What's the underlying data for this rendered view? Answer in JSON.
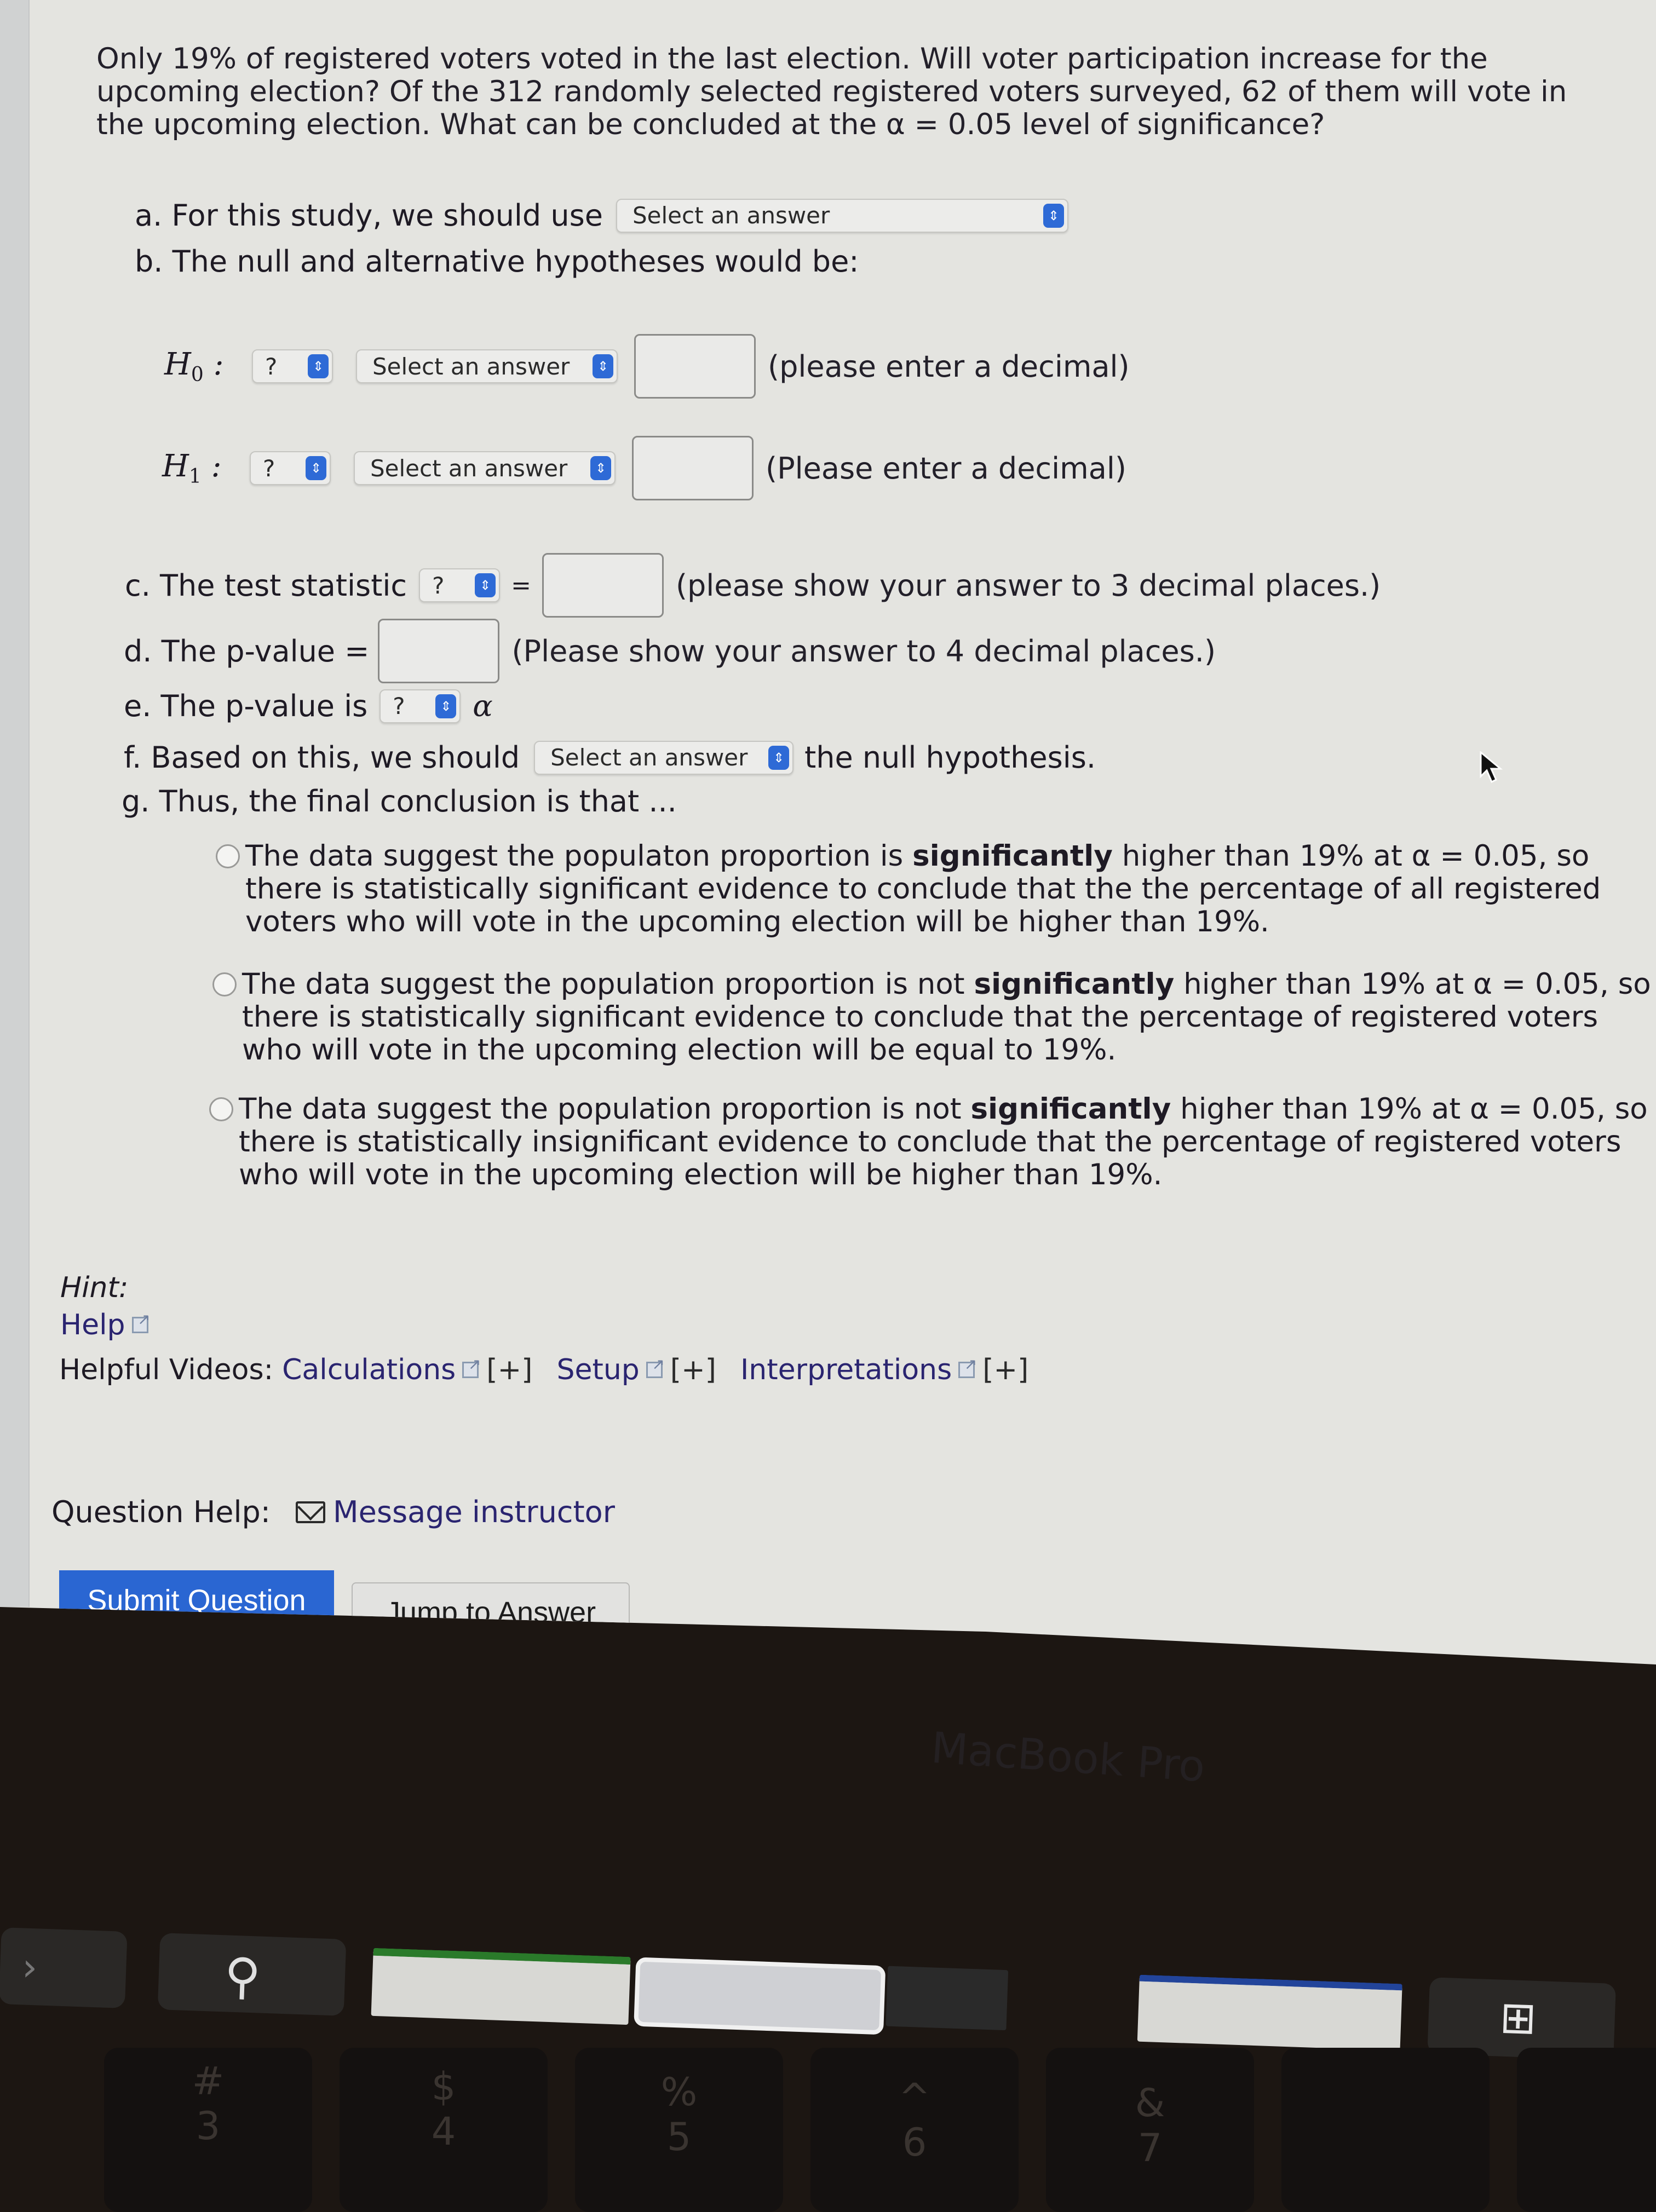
{
  "question": {
    "text": "Only 19% of registered voters voted in the last election. Will voter participation increase for the upcoming election? Of the 312 randomly selected registered voters surveyed, 62 of them will vote in the upcoming election. What can be concluded at the α = 0.05 level of significance?"
  },
  "part_a": {
    "label": "a. For this study, we should use",
    "select_value": "Select an answer"
  },
  "part_b": {
    "label": "b. The null and alternative hypotheses would be:",
    "h0": {
      "symbol": "H",
      "subscript": "0",
      "colon": ":",
      "param_select": "?",
      "op_select": "Select an answer",
      "value": "",
      "note": "(please enter a decimal)"
    },
    "h1": {
      "symbol": "H",
      "subscript": "1",
      "colon": ":",
      "param_select": "?",
      "op_select": "Select an answer",
      "value": "",
      "note": "(Please enter a decimal)"
    }
  },
  "part_c": {
    "label": "c. The test statistic",
    "stat_select": "?",
    "equals": "=",
    "value": "",
    "note": "(please show your answer to 3 decimal places.)"
  },
  "part_d": {
    "label": "d. The p-value =",
    "value": "",
    "note": "(Please show your answer to 4 decimal places.)"
  },
  "part_e": {
    "label": "e. The p-value is",
    "compare_select": "?",
    "alpha": "α"
  },
  "part_f": {
    "label": "f. Based on this, we should",
    "select_value": "Select an answer",
    "suffix": "the null hypothesis."
  },
  "part_g": {
    "label": "g. Thus, the final conclusion is that ...",
    "options": [
      {
        "pre": "The data suggest the populaton proportion is ",
        "bold": "significantly",
        "post": " higher than 19% at α = 0.05, so there is statistically significant evidence to conclude that the the percentage of all registered voters who will vote in the upcoming election will be higher than 19%.",
        "selected": false
      },
      {
        "pre": "The data suggest the population proportion is not ",
        "bold": "significantly",
        "post": " higher than 19% at α = 0.05, so there is statistically significant evidence to conclude that the percentage of registered voters who will vote in the upcoming election will be equal to 19%.",
        "selected": false
      },
      {
        "pre": "The data suggest the population proportion is not ",
        "bold": "significantly",
        "post": " higher than 19% at α = 0.05, so there is statistically insignificant evidence to conclude that the percentage of registered voters who will vote in the upcoming election will be higher than 19%.",
        "selected": false
      }
    ]
  },
  "hint": {
    "label": "Hint:",
    "help_link": "Help",
    "videos_label": "Helpful Videos:",
    "videos": [
      {
        "label": "Calculations",
        "expand": "[+]"
      },
      {
        "label": "Setup",
        "expand": "[+]"
      },
      {
        "label": "Interpretations",
        "expand": "[+]"
      }
    ]
  },
  "question_help": {
    "label": "Question Help:",
    "message_link": "Message instructor"
  },
  "buttons": {
    "submit": "Submit Question",
    "jump": "Jump to Answer"
  },
  "device": {
    "bezel_label": "MacBook Pro",
    "keys": [
      {
        "top": "#",
        "bottom": "3"
      },
      {
        "top": "$",
        "bottom": "4"
      },
      {
        "top": "%",
        "bottom": "5"
      },
      {
        "top": "^",
        "bottom": "6"
      },
      {
        "top": "&",
        "bottom": "7"
      }
    ]
  },
  "colors": {
    "accent_blue": "#2a66d2",
    "link": "#2a2470",
    "page_bg": "#e4e4e0"
  }
}
